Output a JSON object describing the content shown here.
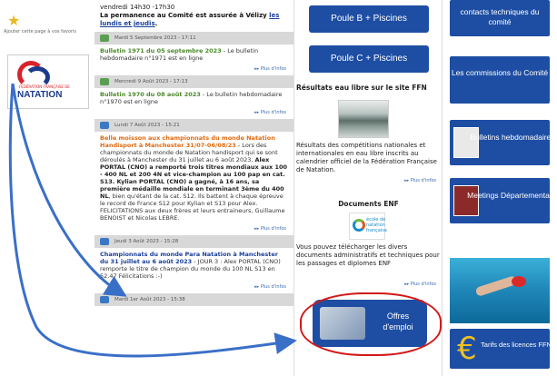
{
  "left": {
    "favorite_text": "Ajouter cette page à vos favoris",
    "logo_word": "NATATION",
    "logo_sub": "FÉDÉRATION FRANÇAISE DE"
  },
  "news": {
    "top_line1": "vendredi 14h30 -17h30",
    "top_line2_prefix": "La permanence au Comité est assurée à Vélizy ",
    "top_line2_link": "les lundis et jeudis",
    "top_line2_suffix": ".",
    "items": [
      {
        "date": "Mardi 5 Septembre 2023 - 17:11",
        "title": "Bulletin 1971 du 05 septembre 2023",
        "text": " - Le bulletin hebdomadaire n°1971 est en ligne",
        "more": "Plus d'infos"
      },
      {
        "date": "Mercredi 9 Août 2023 - 17:13",
        "title": "Bulletin 1970 du 08 août 2023",
        "text": " - Le bulletin hebdomadaire n°1970 est en ligne",
        "more": "Plus d'infos"
      },
      {
        "date": "Lundi 7 Août 2023 - 15:21",
        "title": "Belle moisson aux championnats du monde Natation Handisport à Manchester 31/07-06/08/23",
        "text1": " - Lors des championnats du monde de Natation handisport qui se sont déroulés à Manchester du 31 juillet au 6 août 2023, ",
        "bold1": "Alex PORTAL (CNO) a remporté trois titres mondiaux aux 100 - 400 NL et 200 4N et vice-champion au 100 pap en cat. S13. Kylian PORTAL (CNO) a gagné, à 16 ans, sa première médaille mondiale en terminant 3ème du 400 NL",
        "text2": ", bien qu'étant de la cat. S12. Ils battent à chaque épreuve le record de France S12 pour Kylian et S13 pour Alex. FELICITATIONS aux deux frères et leurs entraineurs, Guillaume BENOIST et Nicolas LEBRE.",
        "more": "Plus d'infos"
      },
      {
        "date": "Jeudi 3 Août 2023 - 15:28",
        "title": "Championnats du monde Para Natation à Manchester du 31 juillet au 6 août 2023",
        "text": " - JOUR 3 : Alex PORTAL (CNO) remporte le titre de champion du monde du 100 NL S13 en 52.47  Félicitations :-)",
        "more": "Plus d'infos"
      },
      {
        "date": "Mardi 1er Août 2023 - 15:38"
      }
    ]
  },
  "mid": {
    "btn_poule_b": "Poule B + Piscines",
    "btn_poule_c": "Poule C + Piscines",
    "eau_libre_title": "Résultats eau libre sur le site FFN",
    "eau_libre_text": "Résultats des compétitions nationales et internationales en eau libre inscrits au calendrier officiel de la Fédération Française de Natation.",
    "eau_libre_more": "Plus d'infos",
    "enf_title": "Documents ENF",
    "enf_logo": "école de natation française",
    "enf_text": "Vous pouvez télécharger les divers documents administratifs et techniques pour les passages et diplomes ENF",
    "enf_more": "Plus d'infos",
    "offres_label": "Offres d'emploi"
  },
  "right": {
    "contacts": "contacts techniques du comité",
    "commissions": "Les commissions du Comité",
    "bulletins": "Bulletins hebdomadaires",
    "meetings": "Meetings Départementaux",
    "tarifs": "Tarifs des licences FFN"
  },
  "colors": {
    "brand_blue": "#1e4ea3",
    "highlight_red": "#d31818",
    "title_green": "#4a8a28",
    "title_orange": "#e06a10",
    "arrow_blue": "#3a6fc8"
  }
}
